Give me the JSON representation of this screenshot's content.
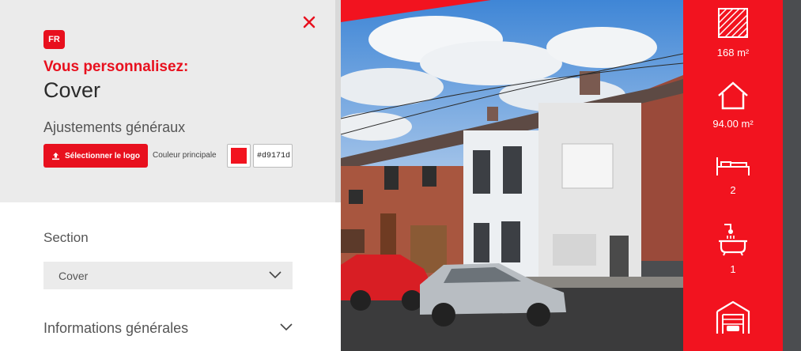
{
  "editor": {
    "language_badge": "FR",
    "subtitle": "Vous personnalisez:",
    "title": "Cover",
    "general_section": "Ajustements généraux",
    "logo_button_label": "Sélectionner le logo",
    "main_color_label": "Couleur principale",
    "main_color_value": "#d9171d",
    "section_label": "Section",
    "section_select_value": "Cover",
    "info_section_label": "Informations générales"
  },
  "preview": {
    "surface": "168 m²",
    "living_area": "94.00 m²",
    "bedrooms": "2",
    "bathrooms": "1",
    "icons": [
      "surface-area-icon",
      "house-icon",
      "bed-icon",
      "bath-icon",
      "garage-icon"
    ]
  },
  "colors": {
    "accent": "#e8101e",
    "panel_bg": "#ebebeb",
    "brand_red": "#f2131f"
  }
}
